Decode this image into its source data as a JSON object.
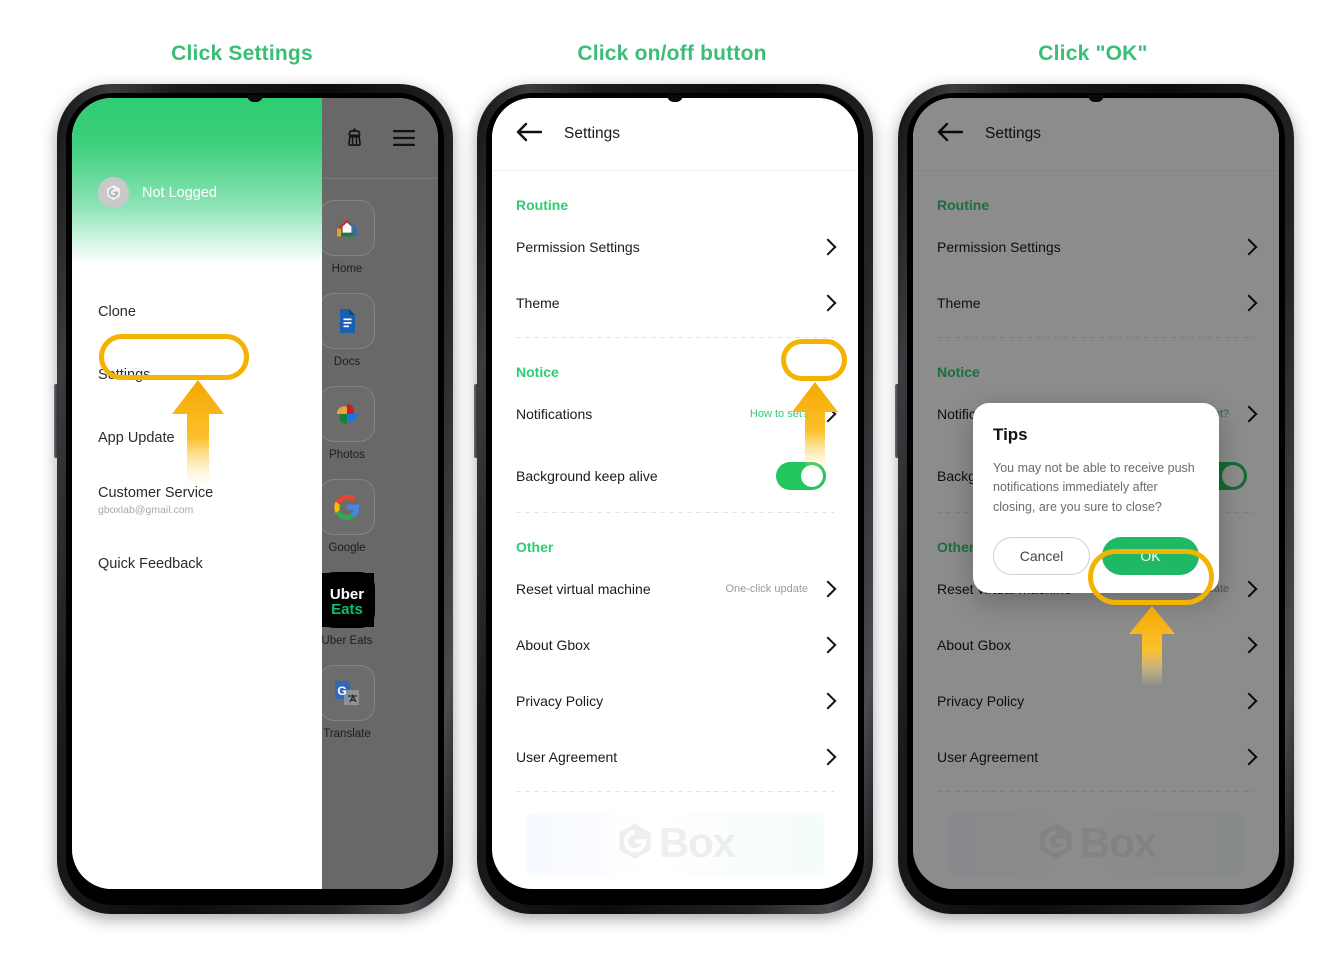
{
  "steps": [
    {
      "caption": "Click Settings"
    },
    {
      "caption": "Click on/off button"
    },
    {
      "caption": "Click \"OK\""
    }
  ],
  "colors": {
    "brand_green": "#2ECC71",
    "caption_green": "#3ABE76",
    "highlight_yellow": "#F5B301",
    "toggle_on": "#22C55E",
    "ok_button": "#1FB865",
    "dim_backdrop": "#686868"
  },
  "phone1": {
    "topbar": {
      "clean_icon": "broom-icon",
      "menu_icon": "hamburger-menu-icon"
    },
    "drawer": {
      "account": {
        "avatar_icon": "gbox-avatar-icon",
        "name": "Not Logged"
      },
      "items": [
        {
          "label": "Clone",
          "sub": ""
        },
        {
          "label": "Settings",
          "sub": ""
        },
        {
          "label": "App Update",
          "sub": ""
        },
        {
          "label": "Customer Service",
          "sub": "gboxlab@gmail.com"
        },
        {
          "label": "Quick Feedback",
          "sub": ""
        }
      ]
    },
    "apps": [
      {
        "label": "Home",
        "icon": "google-home-icon"
      },
      {
        "label": "Docs",
        "icon": "google-docs-icon"
      },
      {
        "label": "Photos",
        "icon": "google-photos-icon"
      },
      {
        "label": "Google",
        "icon": "google-g-icon"
      },
      {
        "label": "Uber Eats",
        "icon": "uber-eats-icon"
      },
      {
        "label": "Translate",
        "icon": "google-translate-icon"
      }
    ]
  },
  "settings": {
    "topbar": {
      "back_icon": "back-arrow-icon",
      "title": "Settings"
    },
    "groups": [
      {
        "title": "Routine",
        "rows": [
          {
            "label": "Permission Settings",
            "hint": "",
            "hint_style": "",
            "control": "chevron"
          },
          {
            "label": "Theme",
            "hint": "",
            "hint_style": "",
            "control": "chevron"
          }
        ]
      },
      {
        "title": "Notice",
        "rows": [
          {
            "label": "Notifications",
            "hint": "How to set?",
            "hint_style": "green",
            "control": "chevron"
          },
          {
            "label": "Background keep alive",
            "hint": "",
            "hint_style": "",
            "control": "toggle"
          }
        ]
      },
      {
        "title": "Other",
        "rows": [
          {
            "label": "Reset virtual machine",
            "hint": "One-click update",
            "hint_style": "grey",
            "control": "chevron"
          },
          {
            "label": "About Gbox",
            "hint": "",
            "hint_style": "",
            "control": "chevron"
          },
          {
            "label": "Privacy Policy",
            "hint": "",
            "hint_style": "",
            "control": "chevron"
          },
          {
            "label": "User Agreement",
            "hint": "",
            "hint_style": "",
            "control": "chevron"
          }
        ]
      }
    ],
    "watermark": {
      "icon": "gbox-logo-icon",
      "text": "Box"
    }
  },
  "dialog": {
    "title": "Tips",
    "message": "You may not be able to receive push notifications immediately after closing, are you sure to close?",
    "cancel_label": "Cancel",
    "ok_label": "OK"
  }
}
